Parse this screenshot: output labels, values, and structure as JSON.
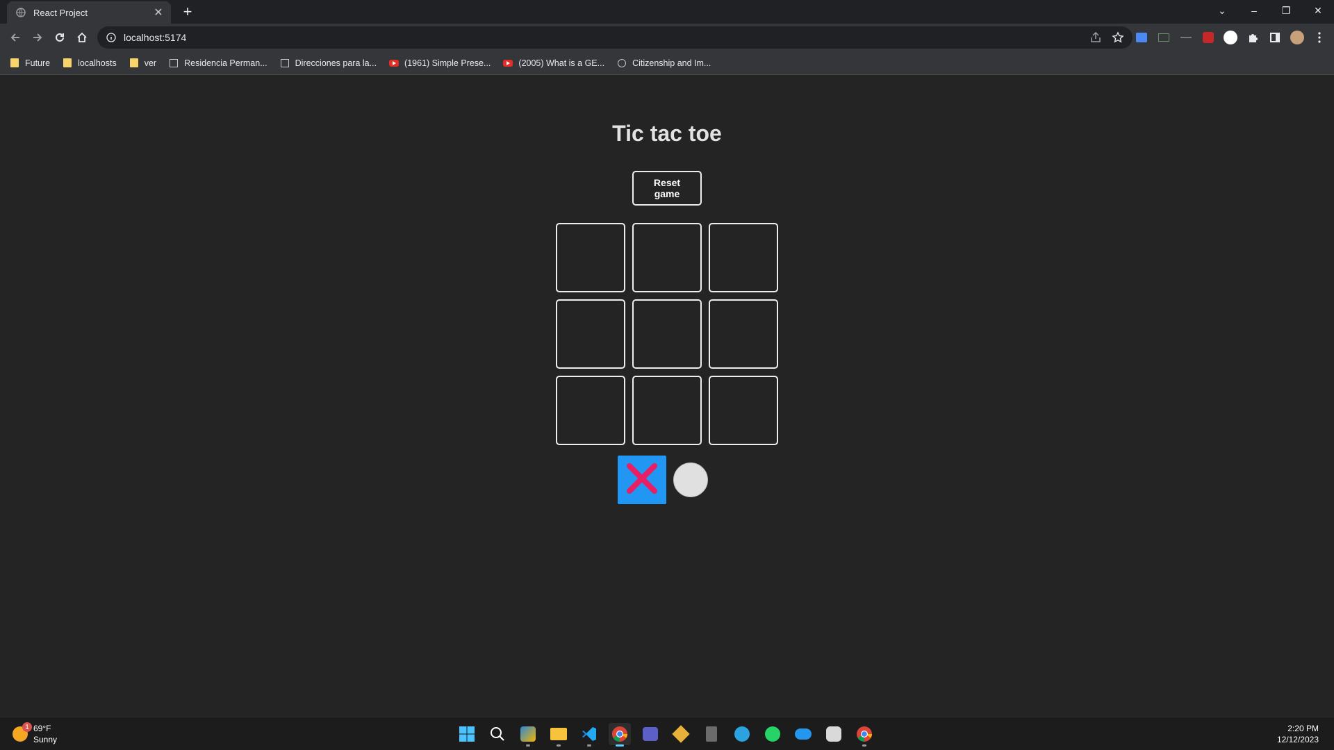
{
  "browser": {
    "tab_title": "React Project",
    "new_tab_symbol": "+",
    "url": "localhost:5174",
    "bookmarks": [
      {
        "label": "Future",
        "icon": "folder-icon"
      },
      {
        "label": "localhosts",
        "icon": "folder-icon"
      },
      {
        "label": "ver",
        "icon": "folder-icon"
      },
      {
        "label": "Residencia Perman...",
        "icon": "gov-site-icon"
      },
      {
        "label": "Direcciones para la...",
        "icon": "gov-site-icon"
      },
      {
        "label": "(1961) Simple Prese...",
        "icon": "youtube-icon"
      },
      {
        "label": "(2005) What is a GE...",
        "icon": "youtube-icon"
      },
      {
        "label": "Citizenship and Im...",
        "icon": "globe-icon"
      }
    ]
  },
  "game": {
    "title": "Tic tac toe",
    "reset_label": "Reset game",
    "board": [
      "",
      "",
      "",
      "",
      "",
      "",
      "",
      "",
      ""
    ],
    "turn": {
      "current": "X",
      "x_color": "#2196f3",
      "x_mark_color": "#e91e63"
    }
  },
  "taskbar": {
    "weather_temp": "69°F",
    "weather_desc": "Sunny",
    "weather_badge": "1",
    "time": "2:20 PM",
    "date": "12/12/2023"
  }
}
